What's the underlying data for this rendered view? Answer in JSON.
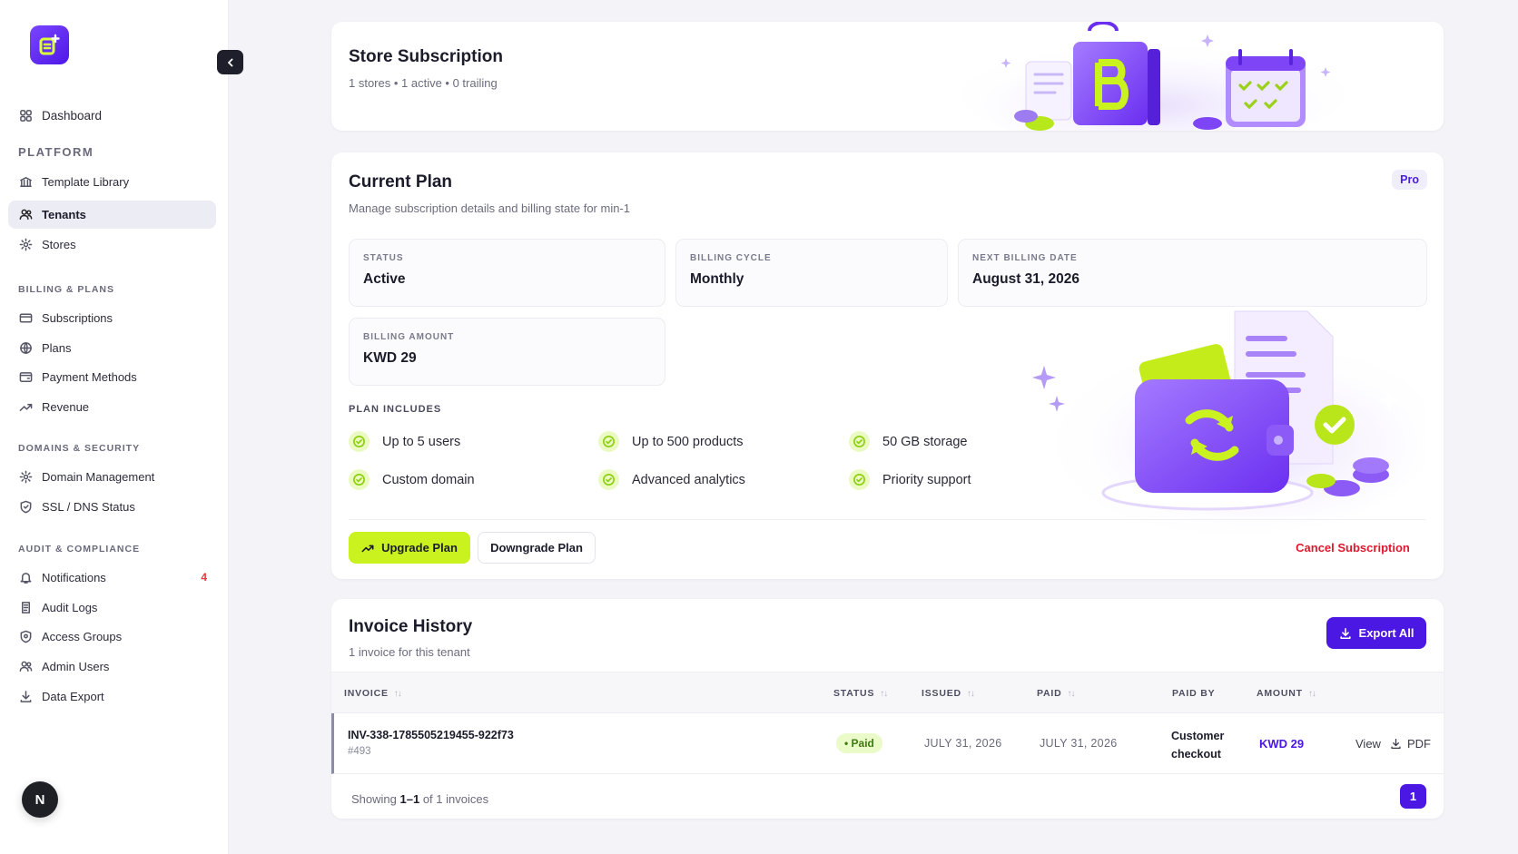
{
  "sidebar": {
    "dashboard": "Dashboard",
    "sections": {
      "platform": "PLATFORM",
      "billing": "BILLING & PLANS",
      "domains": "DOMAINS & SECURITY",
      "audit": "AUDIT & COMPLIANCE"
    },
    "items": {
      "template_library": "Template Library",
      "tenants": "Tenants",
      "stores": "Stores",
      "subscriptions": "Subscriptions",
      "plans": "Plans",
      "payment_methods": "Payment Methods",
      "revenue": "Revenue",
      "domain_management": "Domain Management",
      "ssl_dns": "SSL / DNS Status",
      "notifications": "Notifications",
      "audit_logs": "Audit Logs",
      "access_groups": "Access Groups",
      "admin_users": "Admin Users",
      "data_export": "Data Export"
    },
    "notifications_count": "4",
    "avatar_initial": "N",
    "collapse_icon": "chevron-left-icon"
  },
  "store_subscription": {
    "title": "Store Subscription",
    "summary": "1 stores • 1 active • 0 trailing"
  },
  "current_plan": {
    "title": "Current Plan",
    "subtitle": "Manage subscription details and billing state for min-1",
    "badge": "Pro",
    "stats": {
      "status_label": "STATUS",
      "status_value": "Active",
      "cycle_label": "BILLING CYCLE",
      "cycle_value": "Monthly",
      "next_label": "NEXT BILLING DATE",
      "next_value": "August 31, 2026",
      "amount_label": "BILLING AMOUNT",
      "amount_value": "KWD 29"
    },
    "includes_label": "PLAN INCLUDES",
    "features": {
      "f1": "Up to 5 users",
      "f2": "Up to 500 products",
      "f3": "50 GB storage",
      "f4": "Custom domain",
      "f5": "Advanced analytics",
      "f6": "Priority support"
    },
    "buttons": {
      "upgrade": "Upgrade Plan",
      "downgrade": "Downgrade Plan",
      "cancel": "Cancel Subscription"
    }
  },
  "invoice_history": {
    "title": "Invoice History",
    "subtitle": "1 invoice for this tenant",
    "export_label": "Export All",
    "columns": {
      "invoice": "INVOICE",
      "status": "STATUS",
      "issued": "ISSUED",
      "paid": "PAID",
      "paid_by": "PAID BY",
      "amount": "AMOUNT"
    },
    "rows": [
      {
        "invoice": "INV-338-1785505219455-922f73",
        "ref": "#493",
        "status": "Paid",
        "issued": "JULY 31, 2026",
        "paid": "JULY 31, 2026",
        "paid_by_1": "Customer",
        "paid_by_2": "checkout",
        "amount": "KWD 29",
        "view": "View",
        "pdf": "PDF"
      }
    ],
    "footer": {
      "prefix": "Showing",
      "range": "1–1",
      "suffix": "of 1 invoices"
    },
    "page": "1"
  },
  "colors": {
    "accent": "#4b17e3",
    "lime": "#c9f21e",
    "danger": "#e0182e"
  }
}
